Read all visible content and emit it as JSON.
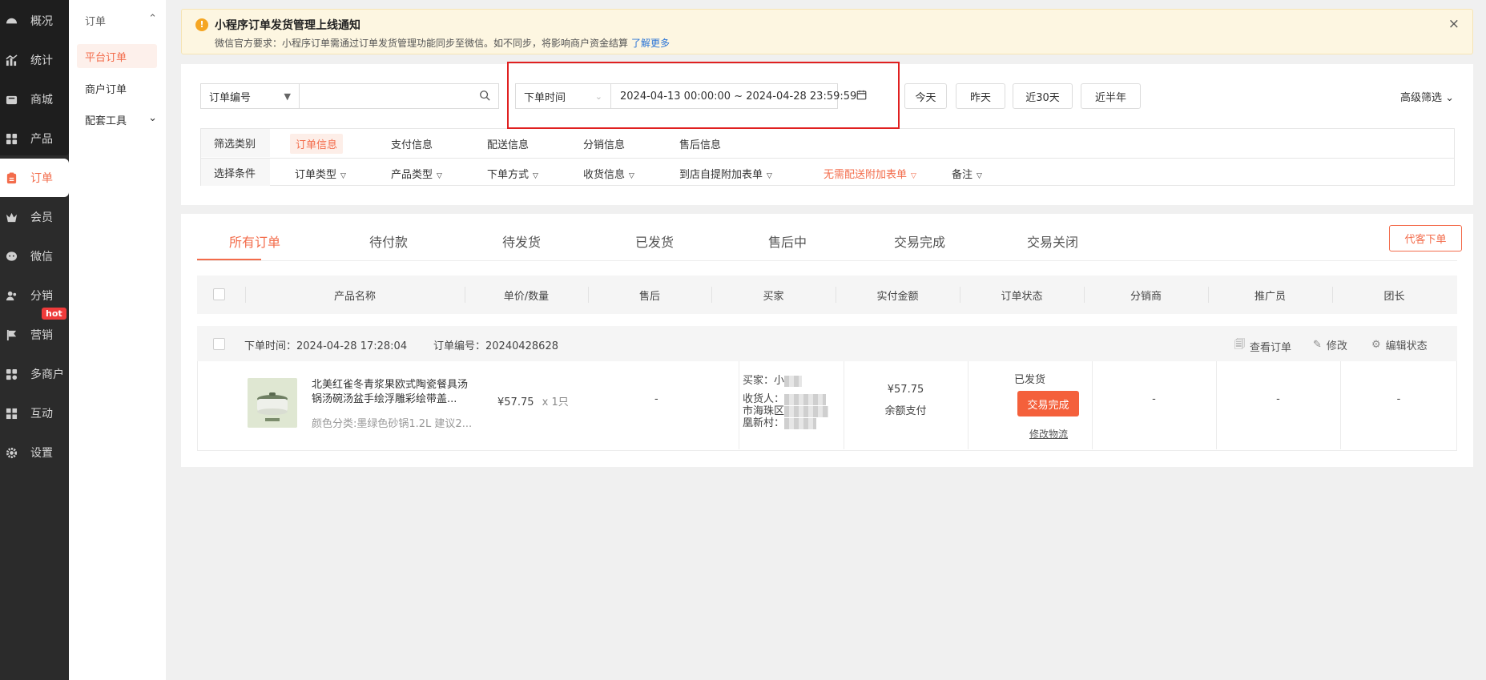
{
  "sidebar": {
    "items": [
      {
        "label": "概况",
        "icon": "gauge-icon"
      },
      {
        "label": "统计",
        "icon": "chart-icon"
      },
      {
        "label": "商城",
        "icon": "store-icon"
      },
      {
        "label": "产品",
        "icon": "grid-icon"
      },
      {
        "label": "订单",
        "icon": "clipboard-icon"
      },
      {
        "label": "会员",
        "icon": "crown-icon"
      },
      {
        "label": "微信",
        "icon": "wechat-icon"
      },
      {
        "label": "分销",
        "icon": "users-icon"
      },
      {
        "label": "营销",
        "icon": "flag-icon"
      },
      {
        "label": "多商户",
        "icon": "shop-icon"
      },
      {
        "label": "互动",
        "icon": "blocks-icon"
      },
      {
        "label": "设置",
        "icon": "gear-icon"
      }
    ],
    "active_index": 4,
    "hot_badge": "hot"
  },
  "subnav": {
    "group": "订单",
    "items": [
      "平台订单",
      "商户订单"
    ],
    "active_index": 0,
    "tool_group": "配套工具"
  },
  "notice": {
    "title": "小程序订单发货管理上线通知",
    "desc": "微信官方要求：小程序订单需通过订单发货管理功能同步至微信。如不同步，将影响商户资金结算",
    "link": "了解更多",
    "close": "×"
  },
  "search": {
    "field_select": "订单编号",
    "keyword": "",
    "time_select": "下单时间",
    "date_range": "2024-04-13 00:00:00 ~ 2024-04-28 23:59:59",
    "quick": [
      "今天",
      "昨天",
      "近30天",
      "近半年"
    ],
    "advanced": "高级筛选"
  },
  "filters": {
    "category_label": "筛选类别",
    "categories": [
      "订单信息",
      "支付信息",
      "配送信息",
      "分销信息",
      "售后信息"
    ],
    "active_category": 0,
    "condition_label": "选择条件",
    "conditions": [
      "订单类型",
      "产品类型",
      "下单方式",
      "收货信息",
      "到店自提附加表单",
      "无需配送附加表单",
      "备注"
    ]
  },
  "tabs": {
    "items": [
      "所有订单",
      "待付款",
      "待发货",
      "已发货",
      "售后中",
      "交易完成",
      "交易关闭"
    ],
    "active_index": 0,
    "proxy_order": "代客下单"
  },
  "table": {
    "headers": [
      "产品名称",
      "单价/数量",
      "售后",
      "买家",
      "实付金额",
      "订单状态",
      "分销商",
      "推广员",
      "团长"
    ]
  },
  "order": {
    "time_label": "下单时间：",
    "time": "2024-04-28 17:28:04",
    "no_label": "订单编号：",
    "no": "20240428628",
    "actions": [
      "查看订单",
      "修改",
      "编辑状态"
    ],
    "product_name": "北美红雀冬青浆果欧式陶瓷餐具汤锅汤碗汤盆手绘浮雕彩绘带盖...",
    "product_spec": "颜色分类:墨绿色砂锅1.2L 建议2...",
    "unit_price": "¥57.75",
    "qty": "x 1只",
    "after_sale": "-",
    "buyer_label": "买家：",
    "buyer_name": "小",
    "receiver_label": "收货人：",
    "address_line1": "市海珠区",
    "address_line2": "凰新村：",
    "paid": "¥57.75",
    "pay_method": "余额支付",
    "status": "已发货",
    "status_button": "交易完成",
    "modify_logistics": "修改物流",
    "distributor": "-",
    "promoter": "-",
    "leader": "-"
  },
  "colors": {
    "accent": "#f36c4b",
    "sidebar_bg": "#2b2b2b",
    "highlight_box": "#e02020"
  }
}
